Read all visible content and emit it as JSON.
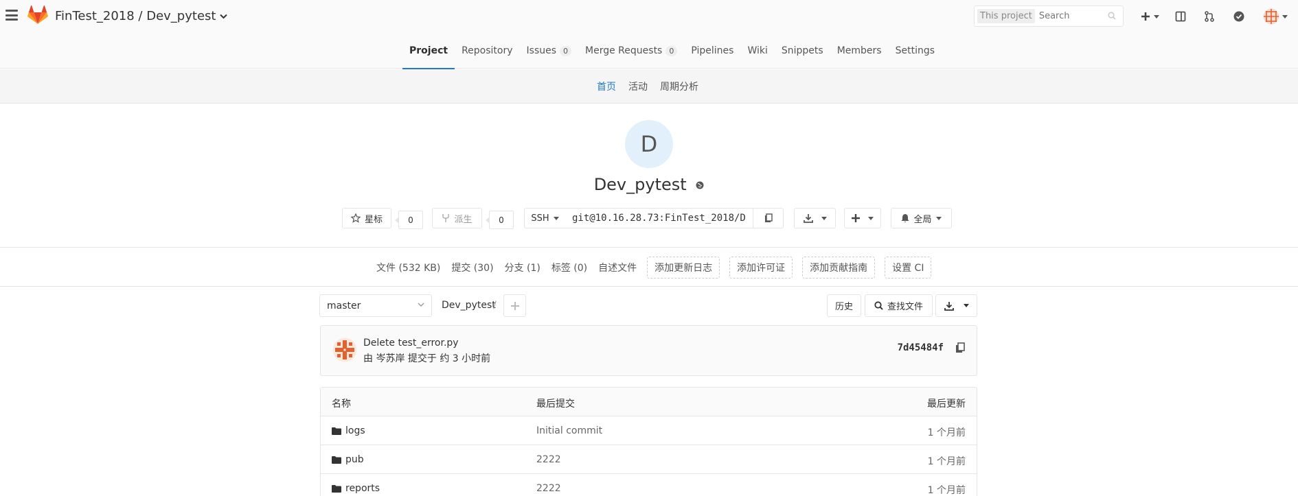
{
  "header": {
    "project_path": "FinTest_2018 / Dev_pytest",
    "search_scope": "This project",
    "search_placeholder": "Search"
  },
  "project_nav": {
    "tabs": [
      {
        "label": "Project",
        "active": true
      },
      {
        "label": "Repository"
      },
      {
        "label": "Issues",
        "badge": "0"
      },
      {
        "label": "Merge Requests",
        "badge": "0"
      },
      {
        "label": "Pipelines"
      },
      {
        "label": "Wiki"
      },
      {
        "label": "Snippets"
      },
      {
        "label": "Members"
      },
      {
        "label": "Settings"
      }
    ]
  },
  "sub_nav": {
    "items": [
      {
        "label": "首页",
        "active": true
      },
      {
        "label": "活动"
      },
      {
        "label": "周期分析"
      }
    ]
  },
  "project": {
    "avatar_letter": "D",
    "name": "Dev_pytest",
    "star_label": "星标",
    "star_count": "0",
    "fork_label": "派生",
    "fork_count": "0",
    "clone_protocol": "SSH",
    "clone_url": "git@10.16.28.73:FinTest_2018/D",
    "notification_label": "全局"
  },
  "stats": {
    "files": "文件 (532 KB)",
    "commits": "提交 (30)",
    "branches": "分支 (1)",
    "tags": "标签 (0)",
    "readme": "自述文件",
    "add_changelog": "添加更新日志",
    "add_license": "添加许可证",
    "add_contributing": "添加贡献指南",
    "setup_ci": "设置 CI"
  },
  "tree_controls": {
    "branch": "master",
    "breadcrumb": "Dev_pytest",
    "separator": "/",
    "history_label": "历史",
    "find_file_label": "查找文件"
  },
  "last_commit": {
    "title": "Delete test_error.py",
    "meta": "由 岑苏岸 提交于 约 3 小时前",
    "sha": "7d45484f"
  },
  "tree": {
    "headers": {
      "name": "名称",
      "last_commit": "最后提交",
      "last_update": "最后更新"
    },
    "rows": [
      {
        "name": "logs",
        "commit": "Initial commit",
        "updated": "1 个月前"
      },
      {
        "name": "pub",
        "commit": "2222",
        "updated": "1 个月前"
      },
      {
        "name": "reports",
        "commit": "2222",
        "updated": "1 个月前"
      }
    ]
  },
  "colors": {
    "accent": "#1f78d1",
    "gitlab_orange": "#e24329",
    "avatar_bg": "#e1f0fb"
  }
}
